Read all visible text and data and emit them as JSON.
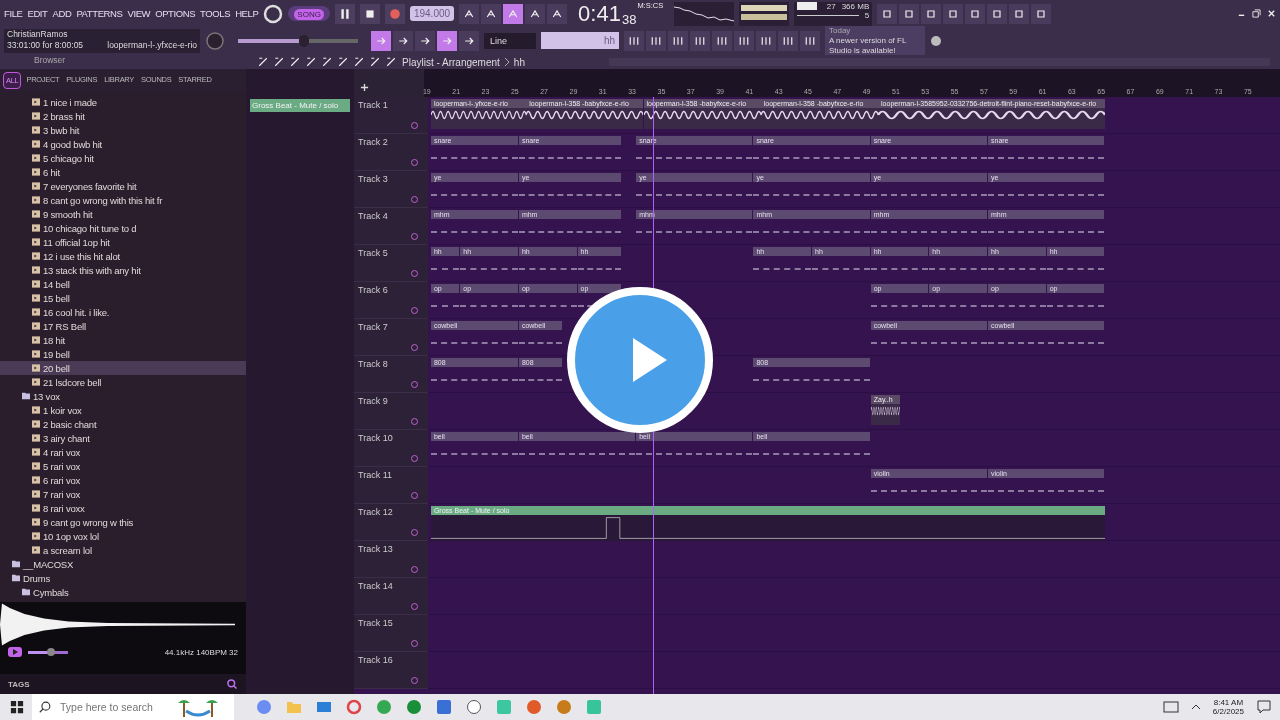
{
  "menu": [
    "FILE",
    "EDIT",
    "ADD",
    "PATTERNS",
    "VIEW",
    "OPTIONS",
    "TOOLS",
    "HELP"
  ],
  "transport": {
    "mode": "SONG",
    "playing": true,
    "tempo": "194.000",
    "time": "0:41",
    "time_sub": "38",
    "time_unit": "M:S:CS",
    "cpu": "27",
    "memory": "366 MB",
    "voices": "5"
  },
  "hint": {
    "user": "ChristianRamos",
    "info": "33:01:00 for 8:00:05",
    "file": "looperman-l-.yfxce-e-rio"
  },
  "master": {
    "level": 0.55
  },
  "snap": "Line",
  "pattern": "hh",
  "news": {
    "when": "Today",
    "message": "A newer version of FL Studio is available!"
  },
  "browser": {
    "title": "Browser",
    "tabs": [
      {
        "label": "ALL",
        "selected": true
      },
      {
        "label": "PROJECT",
        "selected": false
      },
      {
        "label": "PLUGINS",
        "selected": false
      },
      {
        "label": "LIBRARY",
        "selected": false
      },
      {
        "label": "SOUNDS",
        "selected": false
      },
      {
        "label": "STARRED",
        "selected": false
      }
    ],
    "tree": [
      {
        "children": [
          {
            "children": [
              {
                "label": "1 nice i made",
                "selected": false
              },
              {
                "label": "2 brass hit",
                "selected": false
              },
              {
                "label": "3 bwb hit",
                "selected": false
              },
              {
                "label": "4 good bwb hit",
                "selected": false
              },
              {
                "label": "5 chicago hit",
                "selected": false
              },
              {
                "label": "6 hit",
                "selected": false
              },
              {
                "label": "7 everyones favorite hit",
                "selected": false
              },
              {
                "label": "8 cant go wrong with this hit fr",
                "selected": false
              },
              {
                "label": "9 smooth hit",
                "selected": false
              },
              {
                "label": "10 chicago hit tune to d",
                "selected": false
              },
              {
                "label": "11 official 1op hit",
                "selected": false
              },
              {
                "label": "12 i use this hit alot",
                "selected": false
              },
              {
                "label": "13 stack this with any hit",
                "selected": false
              },
              {
                "label": "14 bell",
                "selected": false
              },
              {
                "label": "15 bell",
                "selected": false
              },
              {
                "label": "16 cool hit. i like.",
                "selected": false
              },
              {
                "label": "17 RS Bell",
                "selected": false
              },
              {
                "label": "18 hit",
                "selected": false
              },
              {
                "label": "19 bell",
                "selected": false
              },
              {
                "label": "20 bell",
                "selected": true
              },
              {
                "label": "21 lsdcore bell",
                "selected": false
              }
            ]
          },
          {
            "label": "13 vox",
            "selected": false,
            "children": [
              {
                "label": "1 koir vox",
                "selected": false
              },
              {
                "label": "2 basic chant",
                "selected": false
              },
              {
                "label": "3 airy chant",
                "selected": false
              },
              {
                "label": "4 rari vox",
                "selected": false
              },
              {
                "label": "5 rari vox",
                "selected": false
              },
              {
                "label": "6 rari vox",
                "selected": false
              },
              {
                "label": "7 rari vox",
                "selected": false
              },
              {
                "label": "8 rari voxx",
                "selected": false
              },
              {
                "label": "9 cant go wrong w this",
                "selected": false
              },
              {
                "label": "10 1op vox lol",
                "selected": false
              },
              {
                "label": "a scream lol",
                "selected": false
              }
            ]
          }
        ]
      },
      {
        "label": "__MACOSX",
        "selected": false
      },
      {
        "label": "Drums",
        "selected": false,
        "children": [
          {
            "label": "Cymbals",
            "selected": false
          }
        ]
      }
    ],
    "preview": {
      "info": "44.1kHz 140BPM 32",
      "level": 0.6
    },
    "tags": "TAGS"
  },
  "playlist": {
    "title": "Playlist - Arrangement",
    "pattern": "hh",
    "picker": [
      {
        "label": "Gross Beat - Mute / solo",
        "kind": "automation"
      }
    ],
    "ruler": [
      "19",
      "21",
      "23",
      "25",
      "27",
      "29",
      "31",
      "33",
      "35",
      "37",
      "39",
      "41",
      "43",
      "45",
      "47",
      "49",
      "51",
      "53",
      "55",
      "57",
      "59",
      "61",
      "63",
      "65",
      "67",
      "69",
      "71",
      "73",
      "75"
    ],
    "playhead": {
      "level": 0.267
    },
    "tracks": [
      {
        "name": "Track 1",
        "clips": [
          {
            "kind": "audio",
            "label": "looperman-l-.yfxce-e-rio"
          },
          {
            "kind": "audio",
            "label": "looperman-l-358 -babyfxce-e-rio"
          },
          {
            "kind": "audio",
            "label": "looperman-l-358 -babyfxce-e-rio"
          },
          {
            "kind": "audio",
            "label": "looperman-l-358 -babyfxce-e-rio"
          },
          {
            "kind": "audio",
            "label": "looperman-l-3585952-0332756-detroit-flint-piano-reset-babyfxce-e-rio"
          }
        ]
      },
      {
        "name": "Track 2",
        "clips": [
          {
            "kind": "pattern",
            "label": "snare"
          },
          {
            "kind": "pattern",
            "label": "snare"
          },
          {
            "kind": "pattern",
            "label": "snare"
          },
          {
            "kind": "pattern",
            "label": "snare"
          },
          {
            "kind": "pattern",
            "label": "snare"
          },
          {
            "kind": "pattern",
            "label": "snare"
          }
        ]
      },
      {
        "name": "Track 3",
        "clips": [
          {
            "kind": "pattern",
            "label": "ye"
          },
          {
            "kind": "pattern",
            "label": "ye"
          },
          {
            "kind": "pattern",
            "label": "ye"
          },
          {
            "kind": "pattern",
            "label": "ye"
          },
          {
            "kind": "pattern",
            "label": "ye"
          },
          {
            "kind": "pattern",
            "label": "ye"
          }
        ]
      },
      {
        "name": "Track 4",
        "clips": [
          {
            "kind": "pattern",
            "label": "mhm"
          },
          {
            "kind": "pattern",
            "label": "mhm"
          },
          {
            "kind": "pattern",
            "label": "mhm"
          },
          {
            "kind": "pattern",
            "label": "mhm"
          },
          {
            "kind": "pattern",
            "label": "mhm"
          },
          {
            "kind": "pattern",
            "label": "mhm"
          }
        ]
      },
      {
        "name": "Track 5",
        "clips": [
          {
            "kind": "pattern",
            "label": "hh"
          },
          {
            "kind": "pattern",
            "label": "hh"
          },
          {
            "kind": "pattern",
            "label": "hh"
          },
          {
            "kind": "pattern",
            "label": "hh"
          },
          {
            "kind": "pattern",
            "label": "hh"
          },
          {
            "kind": "pattern",
            "label": "hh"
          },
          {
            "kind": "pattern",
            "label": "hh"
          },
          {
            "kind": "pattern",
            "label": "hh"
          },
          {
            "kind": "pattern",
            "label": "hh"
          },
          {
            "kind": "pattern",
            "label": "hh"
          }
        ]
      },
      {
        "name": "Track 6",
        "clips": [
          {
            "kind": "pattern",
            "label": "op"
          },
          {
            "kind": "pattern",
            "label": "op"
          },
          {
            "kind": "pattern",
            "label": "op"
          },
          {
            "kind": "pattern",
            "label": "op"
          },
          {
            "kind": "pattern",
            "label": "op"
          },
          {
            "kind": "pattern",
            "label": "op"
          },
          {
            "kind": "pattern",
            "label": "op"
          },
          {
            "kind": "pattern",
            "label": "op"
          }
        ]
      },
      {
        "name": "Track 7",
        "clips": [
          {
            "kind": "pattern",
            "label": "cowbell"
          },
          {
            "kind": "pattern",
            "label": "cowbell"
          },
          {
            "kind": "pattern",
            "label": "cowbell"
          },
          {
            "kind": "pattern",
            "label": "cowbell"
          }
        ]
      },
      {
        "name": "Track 8",
        "clips": [
          {
            "kind": "pattern",
            "label": "808"
          },
          {
            "kind": "pattern",
            "label": "808"
          },
          {
            "kind": "pattern",
            "label": "808"
          }
        ]
      },
      {
        "name": "Track 9",
        "clips": [
          {
            "kind": "audio",
            "label": "Zay..h"
          }
        ]
      },
      {
        "name": "Track 10",
        "clips": [
          {
            "kind": "pattern",
            "label": "bell"
          },
          {
            "kind": "pattern",
            "label": "bell"
          },
          {
            "kind": "pattern",
            "label": "bell"
          },
          {
            "kind": "pattern",
            "label": "bell"
          }
        ]
      },
      {
        "name": "Track 11",
        "clips": [
          {
            "kind": "pattern",
            "label": "violin"
          },
          {
            "kind": "pattern",
            "label": "violin"
          }
        ]
      },
      {
        "name": "Track 12",
        "clips": [
          {
            "kind": "automation",
            "label": "Gross Beat - Mute / solo"
          }
        ]
      },
      {
        "name": "Track 13"
      },
      {
        "name": "Track 14"
      },
      {
        "name": "Track 15"
      },
      {
        "name": "Track 16"
      }
    ]
  },
  "taskbar": {
    "search": {
      "placeholder": "Type here to search"
    },
    "time": "8:41 AM",
    "date": "6/2/2025"
  }
}
